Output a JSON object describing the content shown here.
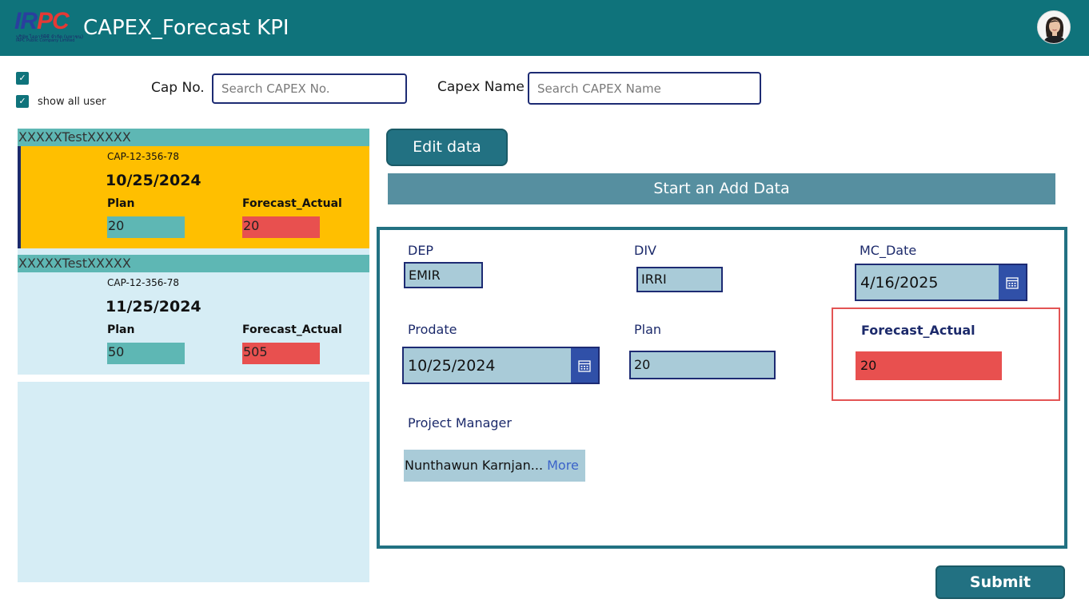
{
  "header": {
    "title": "CAPEX_Forecast KPI",
    "logo": {
      "mark_main": "IR",
      "mark_accent": "PC",
      "line1": "บริษัท ไออาร์พีซี จำกัด (มหาชน)",
      "line2": "IRPC Public Company Limited"
    }
  },
  "filters": {
    "checkbox1_checked": true,
    "show_all_user_label": "show all user",
    "show_all_user_checked": true,
    "cap_no_label": "Cap No.",
    "cap_no_placeholder": "Search CAPEX No.",
    "capex_name_label": "Capex Name",
    "capex_name_placeholder": "Search CAPEX Name"
  },
  "gallery": {
    "items": [
      {
        "name": "XXXXXTestXXXXX",
        "cap_no": "CAP-12-356-78",
        "date": "10/25/2024",
        "plan_label": "Plan",
        "forecast_label": "Forecast_Actual",
        "plan": "20",
        "forecast": "20",
        "selected": true
      },
      {
        "name": "XXXXXTestXXXXX",
        "cap_no": "CAP-12-356-78",
        "date": "11/25/2024",
        "plan_label": "Plan",
        "forecast_label": "Forecast_Actual",
        "plan": "50",
        "forecast": "505",
        "selected": false
      }
    ]
  },
  "actions": {
    "edit_label": "Edit data",
    "banner_label": "Start an Add Data",
    "submit_label": "Submit"
  },
  "form": {
    "dep_label": "DEP",
    "dep_value": "EMIR",
    "div_label": "DIV",
    "div_value": "IRRI",
    "mc_date_label": "MC_Date",
    "mc_date_value": "4/16/2025",
    "prodate_label": "Prodate",
    "prodate_value": "10/25/2024",
    "plan_label": "Plan",
    "plan_value": "20",
    "forecast_label": "Forecast_Actual",
    "forecast_value": "20",
    "pm_label": "Project Manager",
    "pm_value": "Nunthawun Karnjan...",
    "pm_more": "More"
  },
  "icons": [
    "checkbox-check-icon",
    "calendar-icon",
    "avatar-icon"
  ],
  "colors": {
    "header": "#0f737b",
    "selected_card": "#ffbf00",
    "plan_cell": "#5eb7b4",
    "forecast_cell": "#e8504f",
    "button": "#227182",
    "banner": "#568fa0",
    "input_fill": "#a9cbd8"
  }
}
